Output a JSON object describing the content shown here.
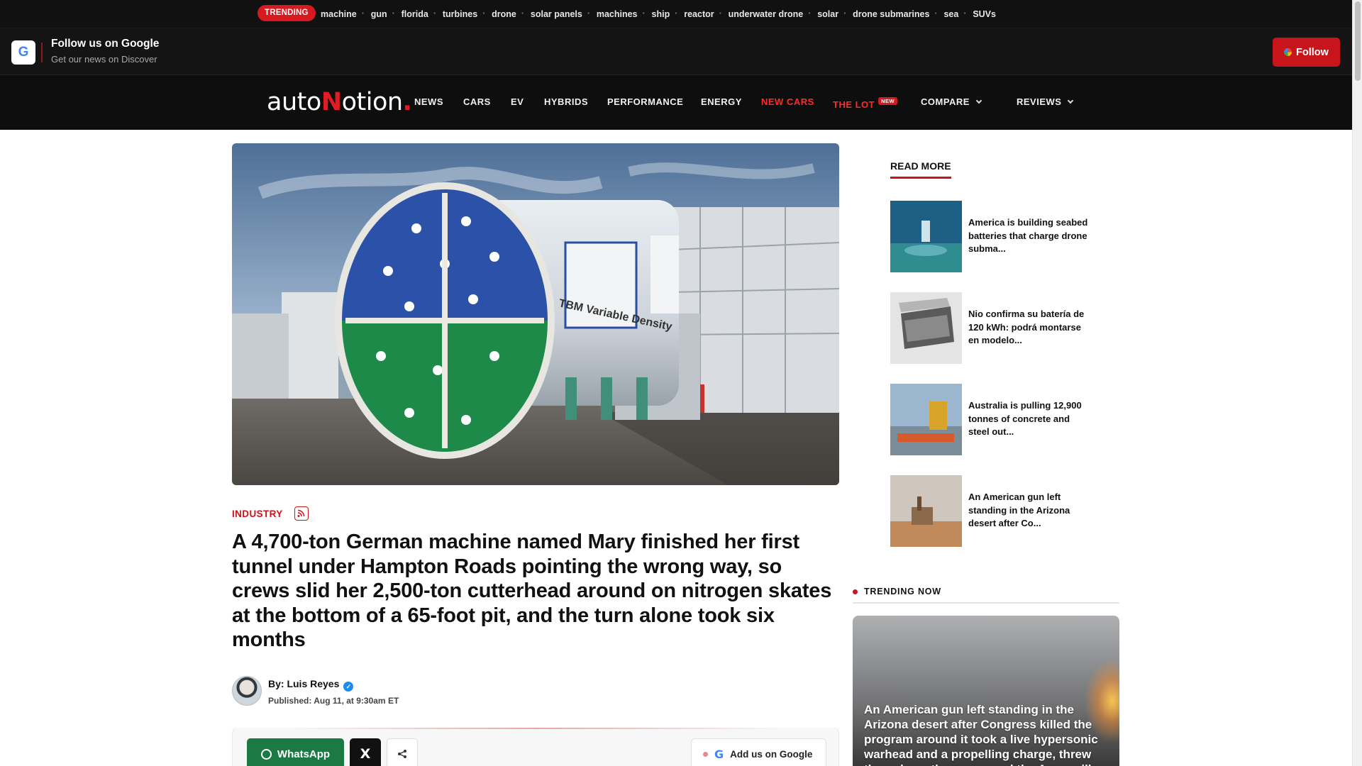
{
  "trending": {
    "badge": "TRENDING",
    "tags": [
      "machine",
      "gun",
      "florida",
      "turbines",
      "drone",
      "solar panels",
      "machines",
      "ship",
      "reactor",
      "underwater drone",
      "solar",
      "drone submarines",
      "sea",
      "SUVs"
    ]
  },
  "follow_bar": {
    "icon": "google-icon",
    "google_letter": "G",
    "title": "Follow us on Google",
    "subtitle": "Get our news on Discover",
    "button_label": "Follow"
  },
  "nav": {
    "logo_prefix": "auto",
    "logo_accent": "N",
    "logo_suffix": "otion",
    "logo_dot": ".",
    "items": [
      "NEWS",
      "CARS",
      "EV",
      "HYBRIDS",
      "PERFORMANCE",
      "ENERGY",
      "NEW CARS",
      "THE LOT",
      "COMPARE",
      "REVIEWS"
    ],
    "new_badge": "NEW"
  },
  "article": {
    "category": "INDUSTRY",
    "headline": "A 4,700-ton German machine named Mary finished her first tunnel under Hampton Roads pointing the wrong way, so crews slid her 2,500-ton cutterhead around on nitrogen skates at the bottom of a 65-foot pit, and the turn alone took six months",
    "byline": "By: Luis Reyes",
    "published": "Published: Aug 11, at 9:30am ET",
    "hero_text": "TBM Variable Density"
  },
  "share": {
    "whatsapp": "WhatsApp",
    "x_label": "X",
    "google": "Add us on Google"
  },
  "read_more": {
    "title": "READ MORE",
    "items": [
      "America is building seabed batteries that charge drone subma...",
      "Nio confirma su batería de 120 kWh: podrá montarse en modelo...",
      "Australia is pulling 12,900 tonnes of concrete and steel out...",
      "An American gun left standing in the Arizona desert after Co..."
    ]
  },
  "trending_now": {
    "title": "TRENDING NOW",
    "card_text": "An American gun left standing in the Arizona desert after Congress killed the program around it took a live hypersonic warhead and a propelling charge, threw them down the range, and the Army will"
  },
  "colors": {
    "accent": "#c8141b",
    "dark_bar": "#111111",
    "whatsapp": "#1b7a43"
  }
}
